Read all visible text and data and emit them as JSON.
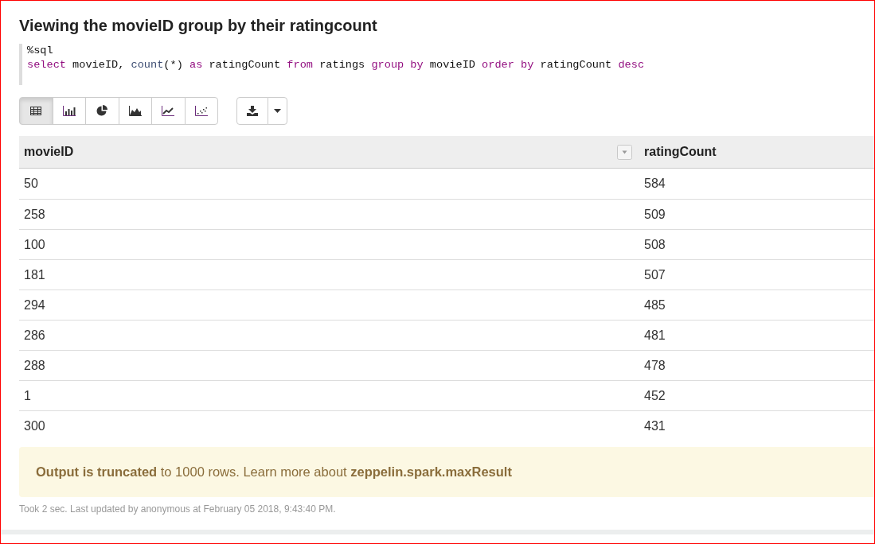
{
  "paragraph": {
    "title": "Viewing the movieID group by their ratingcount",
    "code": [
      [
        {
          "kind": "plain",
          "text": "%sql"
        }
      ],
      [
        {
          "kind": "keyword",
          "text": "select"
        },
        {
          "kind": "plain",
          "text": " movieID, "
        },
        {
          "kind": "function",
          "text": "count"
        },
        {
          "kind": "plain",
          "text": "(*) "
        },
        {
          "kind": "keyword",
          "text": "as"
        },
        {
          "kind": "plain",
          "text": " ratingCount "
        },
        {
          "kind": "keyword",
          "text": "from"
        },
        {
          "kind": "plain",
          "text": " ratings "
        },
        {
          "kind": "keyword",
          "text": "group by"
        },
        {
          "kind": "plain",
          "text": " movieID "
        },
        {
          "kind": "keyword",
          "text": "order by"
        },
        {
          "kind": "plain",
          "text": " ratingCount "
        },
        {
          "kind": "keyword",
          "text": "desc"
        }
      ]
    ]
  },
  "toolbar": {
    "views": [
      {
        "kind": "table",
        "selected": true
      },
      {
        "kind": "bar",
        "selected": false
      },
      {
        "kind": "pie",
        "selected": false
      },
      {
        "kind": "area",
        "selected": false
      },
      {
        "kind": "line",
        "selected": false
      },
      {
        "kind": "scatter",
        "selected": false
      }
    ]
  },
  "table": {
    "columns": [
      "movieID",
      "ratingCount"
    ],
    "rows": [
      [
        "50",
        "584"
      ],
      [
        "258",
        "509"
      ],
      [
        "100",
        "508"
      ],
      [
        "181",
        "507"
      ],
      [
        "294",
        "485"
      ],
      [
        "286",
        "481"
      ],
      [
        "288",
        "478"
      ],
      [
        "1",
        "452"
      ],
      [
        "300",
        "431"
      ]
    ]
  },
  "alert": {
    "text": "**Output is truncated** to 1000 rows. Learn more about **zeppelin.spark.maxResult**"
  },
  "status": "Took 2 sec. Last updated by anonymous at February 05 2018, 9:43:40 PM."
}
